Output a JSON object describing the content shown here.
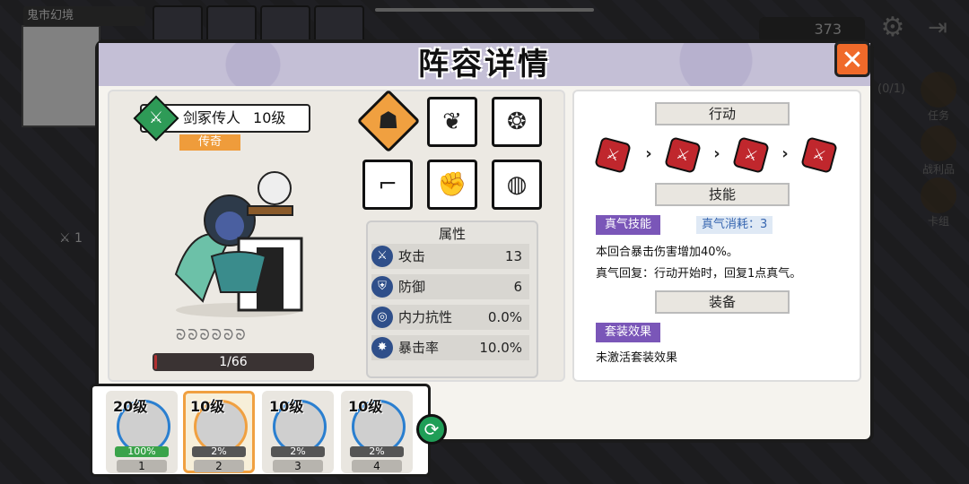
{
  "background": {
    "area_name": "鬼市幻境",
    "currency_value": "373",
    "quest_count": "(0/1)",
    "side_buttons": [
      "任务",
      "战利品",
      "卡组"
    ],
    "left_counter": "1"
  },
  "panel": {
    "title": "阵容详情",
    "close_label": "✕"
  },
  "hero": {
    "name": "剑冢传人",
    "level": "10级",
    "rarity": "传奇",
    "stars": "ᘐᘐᘐᘐᘐᘐ",
    "exp": "1/66",
    "exp_fraction": 0.015
  },
  "equipment": [
    {
      "icon": "hero-portrait-icon",
      "glyph": "☗"
    },
    {
      "icon": "armor-icon",
      "glyph": "❦"
    },
    {
      "icon": "helmet-icon",
      "glyph": "❂"
    },
    {
      "icon": "boot-icon",
      "glyph": "⌐"
    },
    {
      "icon": "glove-icon",
      "glyph": "✊"
    },
    {
      "icon": "ring-icon",
      "glyph": "◍"
    }
  ],
  "attributes": {
    "title": "属性",
    "rows": [
      {
        "label": "攻击",
        "value": "13",
        "icon": "sword-icon",
        "glyph": "⚔"
      },
      {
        "label": "防御",
        "value": "6",
        "icon": "shield-icon",
        "glyph": "⛨"
      },
      {
        "label": "内力抗性",
        "value": "0.0%",
        "icon": "swirl-icon",
        "glyph": "◎"
      },
      {
        "label": "暴击率",
        "value": "10.0%",
        "icon": "crit-icon",
        "glyph": "✸"
      }
    ]
  },
  "details": {
    "action_header": "行动",
    "skill_header": "技能",
    "equip_header": "装备",
    "skill_tag": "真气技能",
    "skill_cost": "真气消耗：3",
    "skill_desc_1": "本回合暴击伤害增加40%。",
    "skill_desc_2": "真气回复：行动开始时，回复1点真气。",
    "set_tag": "套装效果",
    "set_desc": "未激活套装效果"
  },
  "team": [
    {
      "level": "20级",
      "hp": "100%",
      "num": "1",
      "selected": false,
      "color": "#2a7fd0"
    },
    {
      "level": "10级",
      "hp": "2%",
      "num": "2",
      "selected": true,
      "color": "#f0a040"
    },
    {
      "level": "10级",
      "hp": "2%",
      "num": "3",
      "selected": false,
      "color": "#2a7fd0"
    },
    {
      "level": "10级",
      "hp": "2%",
      "num": "4",
      "selected": false,
      "color": "#2a7fd0"
    }
  ],
  "colors": {
    "accent_orange": "#f06a2a",
    "rarity_orange": "#ef9c3b",
    "tag_purple": "#7a56b8",
    "action_red": "#c0272d",
    "class_green": "#2e9b57"
  }
}
